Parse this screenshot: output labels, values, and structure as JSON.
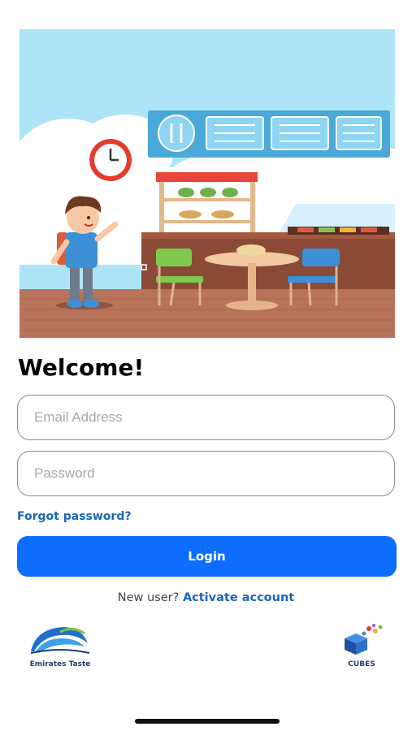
{
  "welcome_title": "Welcome!",
  "email": {
    "placeholder": "Email Address",
    "value": ""
  },
  "password": {
    "placeholder": "Password",
    "value": ""
  },
  "forgot_password": "Forgot password?",
  "login_button": "Login",
  "signup": {
    "prompt": "New user?",
    "link": "Activate account"
  },
  "logos": {
    "left": "Emirates Taste",
    "right": "CUBES"
  },
  "colors": {
    "primary": "#0d6efd",
    "link": "#1967b8",
    "sky": "#aee4f7",
    "floor": "#b8745a"
  }
}
